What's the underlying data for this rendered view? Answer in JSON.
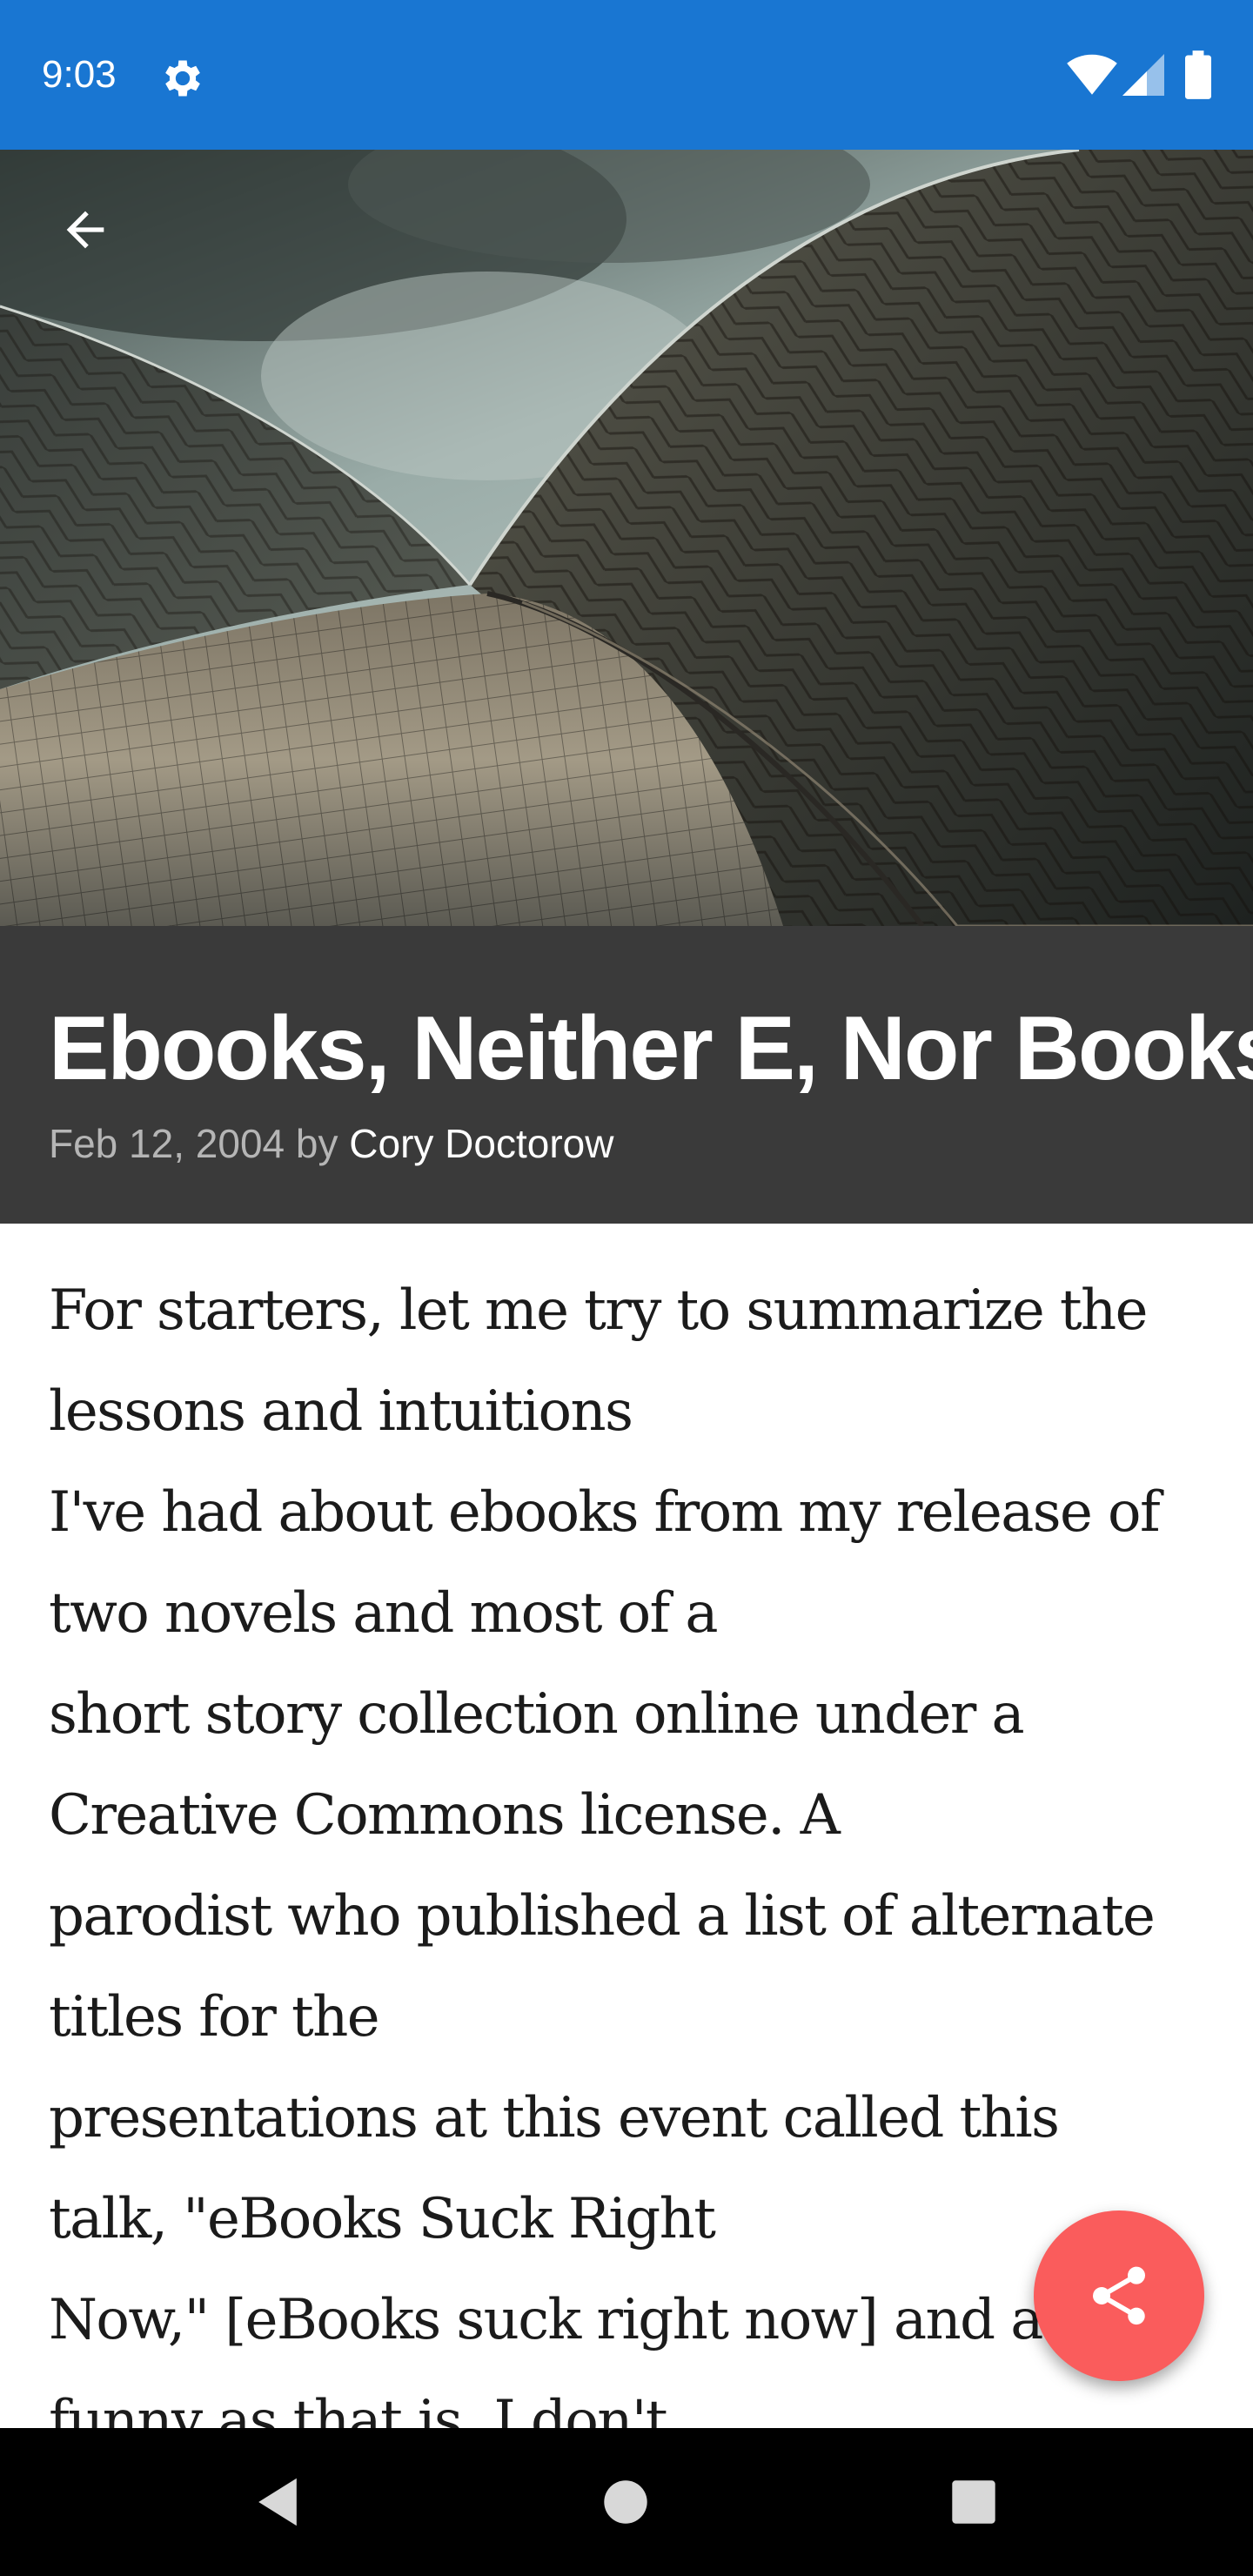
{
  "status_bar": {
    "time": "9:03",
    "icons": [
      "gear-icon",
      "wifi-icon",
      "cell-signal-icon",
      "battery-icon"
    ],
    "background": "#1976d2"
  },
  "toolbar": {
    "back_icon": "arrow-back-icon"
  },
  "article": {
    "title": "Ebooks, Neither E, Nor Books",
    "date": "Feb 12, 2004",
    "by": "by",
    "author": "Cory Doctorow",
    "body_lines": [
      "For starters, let me try to summarize the",
      "lessons and intuitions",
      "I've had about ebooks from my release of",
      "two novels and most of a",
      "short story collection online under a",
      "Creative Commons license. A",
      "parodist who published a list of alternate",
      "titles for the",
      "presentations at this event called this",
      "talk, \"eBooks Suck Right",
      "Now,\" [eBooks suck right now] and as",
      "funny as that is, I don't"
    ]
  },
  "fab": {
    "icon": "share-icon",
    "color": "#fa5c5c"
  },
  "nav_bar": {
    "icons": [
      "nav-back-icon",
      "nav-home-icon",
      "nav-recents-icon"
    ]
  }
}
